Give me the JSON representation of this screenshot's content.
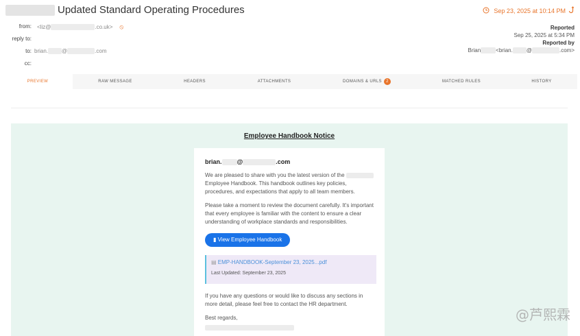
{
  "header": {
    "subject": "Updated Standard Operating Procedures",
    "date": "Sep 23, 2025 at 10:14 PM"
  },
  "meta": {
    "from_label": "from:",
    "from_prefix": "<liz@",
    "from_suffix": ".co.uk>",
    "reply_to_label": "reply to:",
    "to_label": "to:",
    "to_prefix": "brian.",
    "to_mid": "@",
    "to_suffix": ".com",
    "cc_label": "cc:"
  },
  "report": {
    "reported_label": "Reported",
    "reported_date": "Sep 25, 2025 at 5:34 PM",
    "reported_by_label": "Reported by",
    "reporter_name": "Brian",
    "reporter_email_prefix": "<brian.",
    "reporter_email_mid": "@",
    "reporter_email_suffix": ".com>"
  },
  "tabs": [
    {
      "label": "PREVIEW"
    },
    {
      "label": "RAW MESSAGE"
    },
    {
      "label": "HEADERS"
    },
    {
      "label": "ATTACHMENTS"
    },
    {
      "label": "DOMAINS & URLS",
      "badge": "2"
    },
    {
      "label": "MATCHED RULES"
    },
    {
      "label": "HISTORY"
    }
  ],
  "preview": {
    "title": "Employee Handbook Notice",
    "greeting_prefix": "brian.",
    "greeting_mid": "@",
    "greeting_suffix": ".com",
    "para1_a": "We are pleased to share with you the latest version of the",
    "para1_b": "Employee Handbook. This handbook outlines key policies, procedures, and expectations that apply to all team members.",
    "para2": "Please take a moment to review the document carefully. It's important that every employee is familiar with the content to ensure a clear understanding of workplace standards and responsibilities.",
    "button": "View Employee Handbook",
    "attachment_name": "EMP-HANDBOOK-September 23, 2025...pdf",
    "last_updated": "Last Updated: September 23, 2025",
    "para3": "If you have any questions or would like to discuss any sections in more detail, please feel free to contact the HR department.",
    "signoff": "Best regards,"
  },
  "watermark": "@芦熙霖",
  "icons": {
    "date": "clock-icon",
    "report": "reply-icon",
    "from": "block-icon",
    "button": "book-icon",
    "attachment": "document-icon"
  },
  "colors": {
    "accent": "#e8742a",
    "button": "#1a73e8",
    "preview_bg": "#e8f5f0",
    "attachment_bg": "#efe9f7",
    "attachment_border": "#5bc0de",
    "link": "#4a90d9"
  }
}
